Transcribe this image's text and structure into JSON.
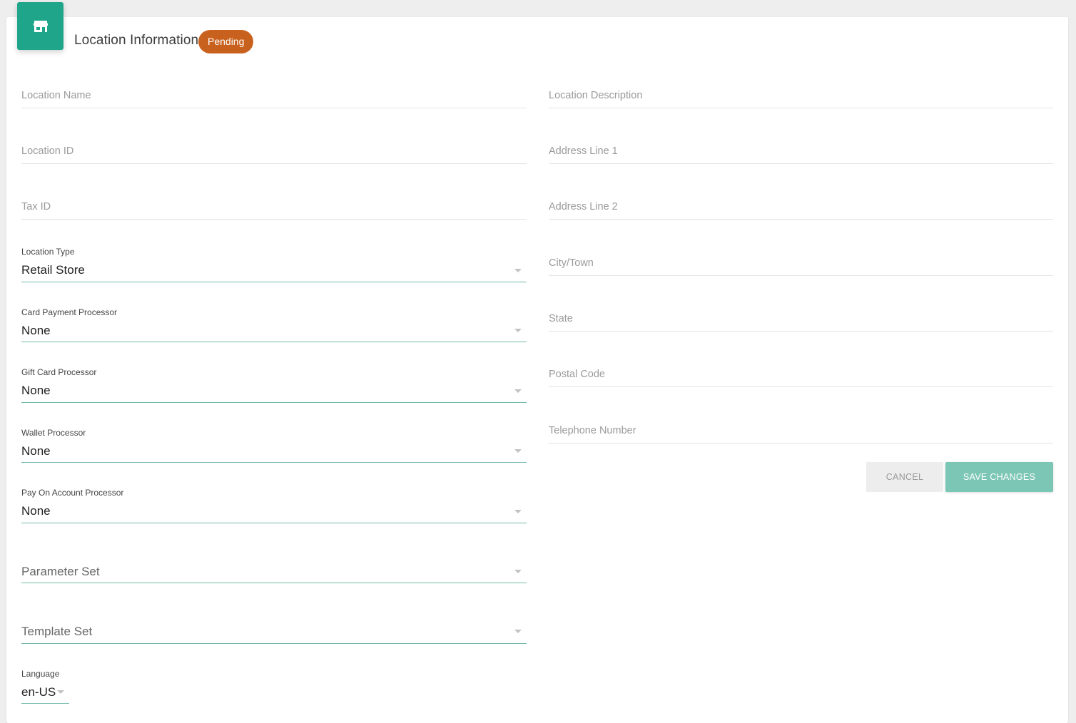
{
  "header": {
    "icon": "store-icon",
    "title": "Location Information",
    "status_badge": "Pending",
    "accent_color": "#1fa58a",
    "badge_color": "#c8611d"
  },
  "left_fields": {
    "location_name": "Location Name",
    "location_id": "Location ID",
    "tax_id": "Tax ID"
  },
  "selects": {
    "location_type": {
      "label": "Location Type",
      "value": "Retail Store"
    },
    "card_payment_processor": {
      "label": "Card Payment Processor",
      "value": "None"
    },
    "gift_card_processor": {
      "label": "Gift Card Processor",
      "value": "None"
    },
    "wallet_processor": {
      "label": "Wallet Processor",
      "value": "None"
    },
    "pay_on_account_processor": {
      "label": "Pay On Account Processor",
      "value": "None"
    },
    "parameter_set": {
      "placeholder": "Parameter Set"
    },
    "template_set": {
      "placeholder": "Template Set"
    },
    "language": {
      "label": "Language",
      "value": "en-US"
    }
  },
  "right_fields": {
    "location_description": "Location Description",
    "address_line_1": "Address Line 1",
    "address_line_2": "Address Line 2",
    "city_town": "City/Town",
    "state": "State",
    "postal_code": "Postal Code",
    "telephone_number": "Telephone Number"
  },
  "actions": {
    "cancel_label": "CANCEL",
    "save_label": "SAVE CHANGES"
  }
}
